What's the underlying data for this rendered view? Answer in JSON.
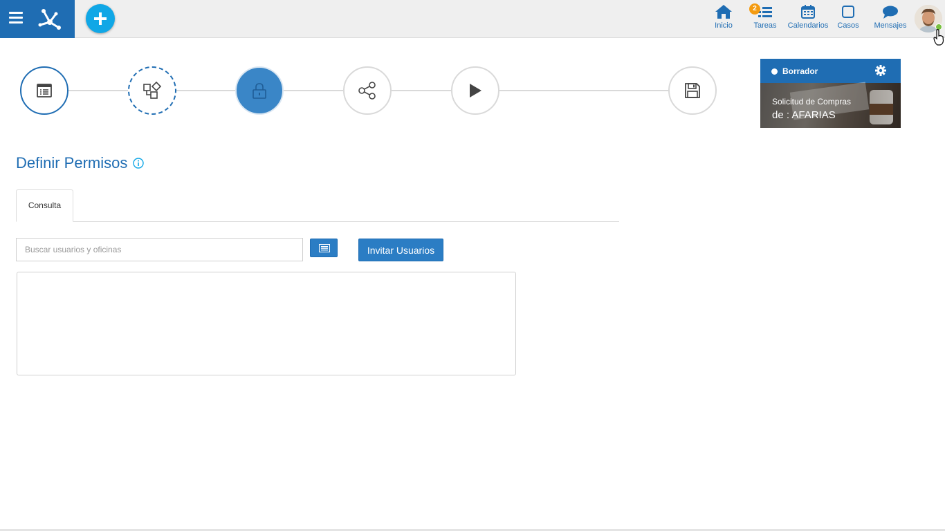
{
  "topbar": {
    "nav": [
      {
        "id": "inicio",
        "label": "Inicio",
        "icon": "home-icon"
      },
      {
        "id": "tareas",
        "label": "Tareas",
        "icon": "tasks-icon",
        "badge": "2"
      },
      {
        "id": "calendarios",
        "label": "Calendarios",
        "icon": "calendar-icon"
      },
      {
        "id": "casos",
        "label": "Casos",
        "icon": "cases-icon"
      },
      {
        "id": "mensajes",
        "label": "Mensajes",
        "icon": "chat-icon"
      }
    ],
    "brand_color": "#1f6db3",
    "add_button_color": "#10a7e6",
    "badge_color": "#f49b10",
    "online_color": "#7ac142"
  },
  "stepper": {
    "steps": [
      {
        "id": "form",
        "icon": "form-icon",
        "state": "done"
      },
      {
        "id": "modules",
        "icon": "shapes-icon",
        "state": "dashed"
      },
      {
        "id": "permissions",
        "icon": "lock-icon",
        "state": "active"
      },
      {
        "id": "share",
        "icon": "share-icon",
        "state": "pending"
      },
      {
        "id": "run",
        "icon": "play-icon",
        "state": "pending"
      },
      {
        "id": "save",
        "icon": "save-icon",
        "state": "pending"
      }
    ]
  },
  "status_card": {
    "status": "Borrador",
    "title": "Solicitud de Compras",
    "subtitle": "de : AFARIAS"
  },
  "main": {
    "title": "Definir Permisos",
    "tabs": [
      {
        "label": "Consulta",
        "active": true
      }
    ],
    "search": {
      "placeholder": "Buscar usuarios y oficinas",
      "value": ""
    },
    "invite_label": "Invitar Usuarios"
  }
}
